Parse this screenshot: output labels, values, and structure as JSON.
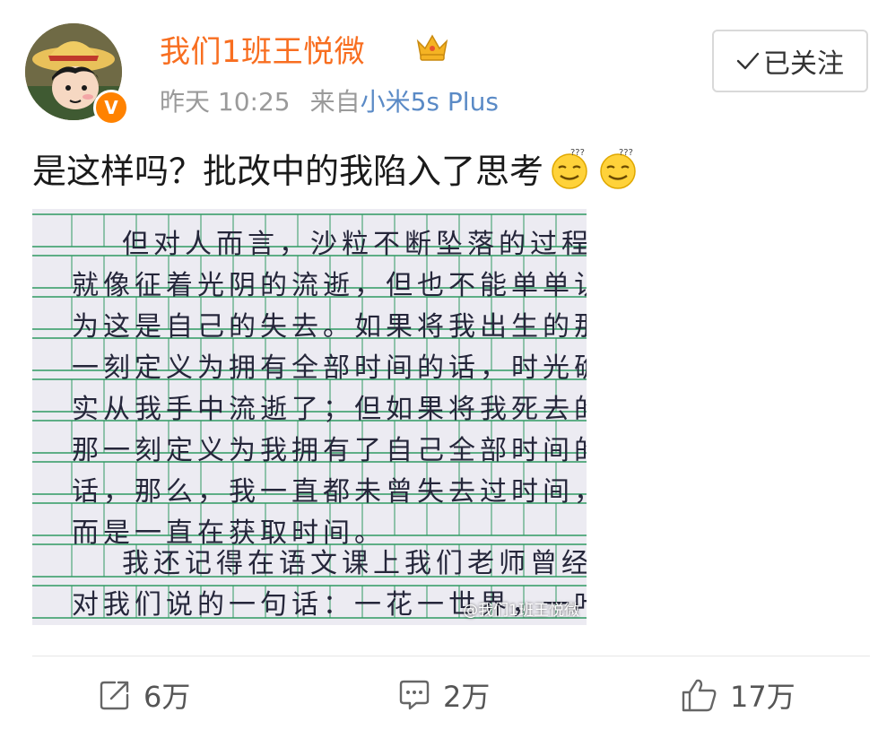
{
  "header": {
    "username": "我们1班王悦微",
    "verified_badge": "V",
    "time": "昨天 10:25",
    "source_prefix": "来自",
    "source": "小米5s Plus",
    "follow_label": "已关注",
    "icons": [
      "crown-icon",
      "verified-icon",
      "check-icon"
    ]
  },
  "post": {
    "text": "是这样吗？批改中的我陷入了思考",
    "emojis": [
      "thinking-emoji",
      "thinking-emoji"
    ]
  },
  "image": {
    "lines": [
      "但对人而言，沙粒不断坠落的过程",
      "就像征着光阴的流逝，但也不能单单认",
      "为这是自己的失去。如果将我出生的那",
      "一刻定义为拥有全部时间的话，时光确",
      "实从我手中流逝了；但如果将我死去的",
      "那一刻定义为我拥有了自己全部时间的",
      "话，那么，我一直都未曾失去过时间，",
      "而是一直在获取时间。",
      "我还记得在语文课上我们老师曾经",
      "对我们说的一句话：一花一世界，一叶"
    ],
    "watermark": "@我们1班王悦微"
  },
  "actions": {
    "repost": "6万",
    "comment": "2万",
    "like": "17万"
  },
  "colors": {
    "username": "#f86e20",
    "source_link": "#5a8ac6",
    "verified": "#ff8200",
    "grid_line": "#2f9a62",
    "paper": "#ecebf2"
  }
}
